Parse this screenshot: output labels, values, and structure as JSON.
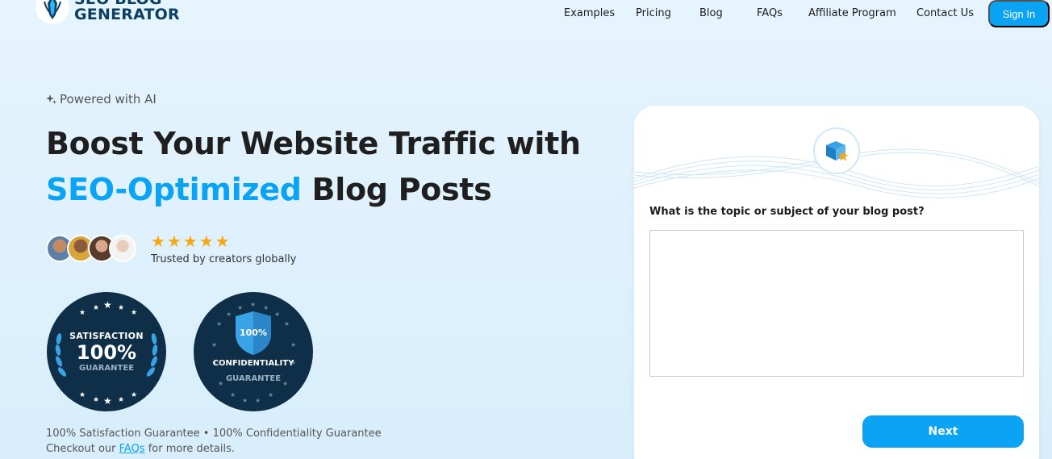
{
  "brand": {
    "line1": "SEO BLOG",
    "line2": "GENERATOR"
  },
  "nav": {
    "items": [
      "Examples",
      "Pricing",
      "Blog",
      "FAQs",
      "Affiliate Program",
      "Contact Us"
    ],
    "signin": "Sign In"
  },
  "hero": {
    "powered": "Powered with AI",
    "headline_line1": "Boost Your Website Traffic with",
    "headline_accent": "SEO-Optimized",
    "headline_rest": " Blog Posts",
    "rating_stars": 5,
    "trusted": "Trusted by creators globally"
  },
  "badges": {
    "satisfaction": {
      "top": "SATISFACTION",
      "value": "100%",
      "bottom": "GUARANTEE"
    },
    "confidentiality": {
      "shield": "100%",
      "top": "CONFIDENTIALITY",
      "bottom": "GUARANTEE"
    }
  },
  "footnotes": {
    "line1": "100% Satisfaction Guarantee • 100% Confidentiality Guarantee",
    "line2_prefix": "Checkout our ",
    "line2_link": "FAQs",
    "line2_suffix": " for more details."
  },
  "card": {
    "question": "What is the topic or subject of your blog post?",
    "next": "Next"
  },
  "colors": {
    "accent": "#0ba3f3",
    "navy": "#0e2f47",
    "star": "#f5a813"
  }
}
